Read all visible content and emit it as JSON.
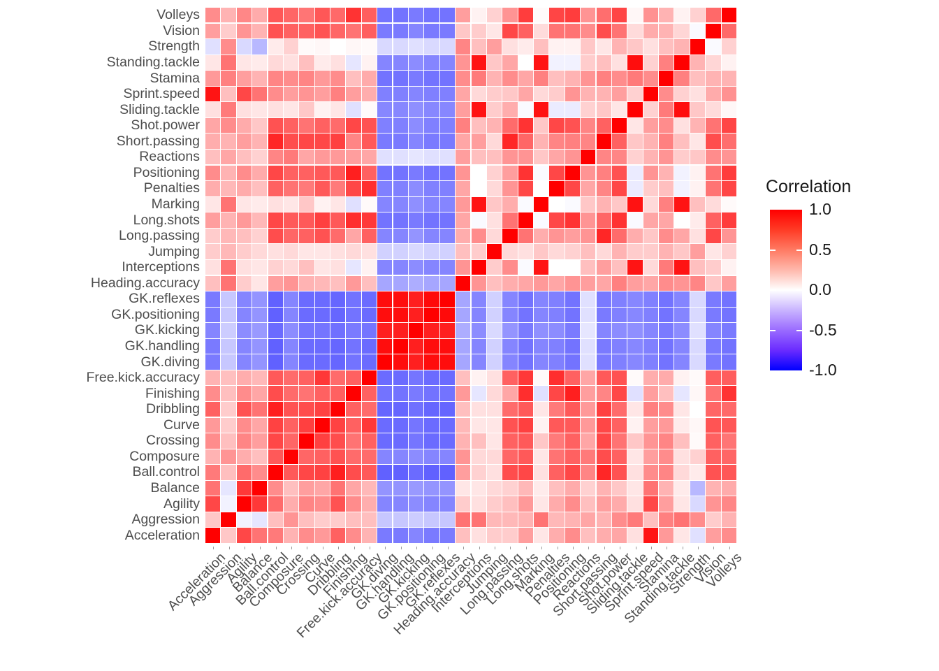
{
  "chart_data": {
    "type": "heatmap",
    "title": "",
    "xlabel": "",
    "ylabel": "",
    "legend": {
      "title": "Correlation",
      "position": "right",
      "ticks": [
        1.0,
        0.5,
        0.0,
        -0.5,
        -1.0
      ],
      "tick_labels": [
        "1.0",
        "0.5",
        "0.0",
        "-0.5",
        "-1.0"
      ],
      "zlim": [
        -1.0,
        1.0
      ],
      "colors": {
        "max": "#ff0000",
        "mid": "#ffffff",
        "min": "#0000ff"
      }
    },
    "grid": false,
    "x_categories": [
      "Acceleration",
      "Aggression",
      "Agility",
      "Balance",
      "Ball.control",
      "Composure",
      "Crossing",
      "Curve",
      "Dribbling",
      "Finishing",
      "Free.kick.accuracy",
      "GK.diving",
      "GK.handling",
      "GK.kicking",
      "GK.positioning",
      "GK.reflexes",
      "Heading.accuracy",
      "Interceptions",
      "Jumping",
      "Long.passing",
      "Long.shots",
      "Marking",
      "Penalties",
      "Positioning",
      "Reactions",
      "Short.passing",
      "Shot.power",
      "Sliding.tackle",
      "Sprint.speed",
      "Stamina",
      "Standing.tackle",
      "Strength",
      "Vision",
      "Volleys"
    ],
    "y_categories": [
      "Volleys",
      "Vision",
      "Strength",
      "Standing.tackle",
      "Stamina",
      "Sprint.speed",
      "Sliding.tackle",
      "Shot.power",
      "Short.passing",
      "Reactions",
      "Positioning",
      "Penalties",
      "Marking",
      "Long.shots",
      "Long.passing",
      "Jumping",
      "Interceptions",
      "Heading.accuracy",
      "GK.reflexes",
      "GK.positioning",
      "GK.kicking",
      "GK.handling",
      "GK.diving",
      "Free.kick.accuracy",
      "Finishing",
      "Dribbling",
      "Curve",
      "Crossing",
      "Composure",
      "Ball.control",
      "Balance",
      "Agility",
      "Aggression",
      "Acceleration"
    ],
    "matrix": [
      [
        0.45,
        0.3,
        0.47,
        0.33,
        0.66,
        0.6,
        0.54,
        0.66,
        0.59,
        0.8,
        0.63,
        -0.55,
        -0.55,
        -0.52,
        -0.55,
        -0.55,
        0.38,
        0.05,
        0.18,
        0.42,
        0.76,
        0.02,
        0.73,
        0.76,
        0.42,
        0.57,
        0.73,
        0.03,
        0.43,
        0.3,
        0.05,
        0.18,
        0.59,
        1.0
      ],
      [
        0.38,
        0.2,
        0.42,
        0.3,
        0.68,
        0.62,
        0.62,
        0.67,
        0.6,
        0.55,
        0.63,
        -0.52,
        -0.52,
        -0.48,
        -0.52,
        -0.52,
        0.22,
        0.2,
        0.1,
        0.72,
        0.62,
        0.14,
        0.55,
        0.55,
        0.45,
        0.7,
        0.55,
        0.14,
        0.33,
        0.3,
        0.16,
        -0.02,
        1.0,
        0.59
      ],
      [
        -0.12,
        0.45,
        -0.15,
        -0.28,
        0.08,
        0.18,
        0.02,
        0.03,
        0.0,
        0.03,
        0.02,
        -0.15,
        -0.15,
        -0.12,
        -0.15,
        -0.15,
        0.48,
        0.25,
        0.38,
        0.12,
        0.08,
        0.25,
        0.05,
        0.05,
        0.22,
        0.1,
        0.3,
        0.22,
        0.12,
        0.25,
        0.3,
        1.0,
        -0.02,
        0.18
      ],
      [
        0.1,
        0.55,
        0.1,
        0.08,
        0.15,
        0.12,
        0.25,
        0.08,
        0.12,
        -0.1,
        0.05,
        -0.48,
        -0.48,
        -0.45,
        -0.48,
        -0.48,
        0.42,
        0.92,
        0.22,
        0.35,
        0.0,
        0.92,
        -0.05,
        -0.05,
        0.2,
        0.25,
        0.12,
        0.95,
        0.18,
        0.5,
        1.0,
        0.3,
        0.16,
        0.05
      ],
      [
        0.4,
        0.5,
        0.38,
        0.3,
        0.48,
        0.45,
        0.48,
        0.4,
        0.45,
        0.25,
        0.33,
        -0.55,
        -0.55,
        -0.52,
        -0.55,
        -0.55,
        0.45,
        0.52,
        0.3,
        0.45,
        0.35,
        0.5,
        0.25,
        0.3,
        0.42,
        0.5,
        0.45,
        0.52,
        0.45,
        1.0,
        0.5,
        0.25,
        0.3,
        0.3
      ],
      [
        0.92,
        0.25,
        0.72,
        0.55,
        0.45,
        0.38,
        0.42,
        0.38,
        0.5,
        0.38,
        0.32,
        -0.5,
        -0.5,
        -0.48,
        -0.5,
        -0.5,
        0.35,
        0.15,
        0.2,
        0.22,
        0.35,
        0.15,
        0.2,
        0.42,
        0.3,
        0.3,
        0.38,
        0.18,
        1.0,
        0.45,
        0.18,
        0.12,
        0.33,
        0.43
      ],
      [
        0.12,
        0.52,
        0.12,
        0.1,
        0.12,
        0.1,
        0.22,
        0.05,
        0.1,
        -0.12,
        0.02,
        -0.47,
        -0.47,
        -0.44,
        -0.47,
        -0.47,
        0.38,
        0.92,
        0.2,
        0.32,
        -0.02,
        0.93,
        -0.08,
        -0.08,
        0.18,
        0.22,
        0.1,
        1.0,
        0.18,
        0.52,
        0.95,
        0.22,
        0.14,
        0.03
      ],
      [
        0.35,
        0.45,
        0.33,
        0.22,
        0.68,
        0.62,
        0.55,
        0.62,
        0.58,
        0.72,
        0.68,
        -0.5,
        -0.5,
        -0.45,
        -0.5,
        -0.5,
        0.5,
        0.25,
        0.3,
        0.58,
        0.8,
        0.22,
        0.72,
        0.68,
        0.48,
        0.62,
        1.0,
        0.1,
        0.38,
        0.45,
        0.12,
        0.3,
        0.55,
        0.73
      ],
      [
        0.32,
        0.3,
        0.38,
        0.3,
        0.85,
        0.7,
        0.72,
        0.72,
        0.75,
        0.48,
        0.65,
        -0.52,
        -0.52,
        -0.48,
        -0.52,
        -0.52,
        0.35,
        0.38,
        0.15,
        0.85,
        0.6,
        0.3,
        0.48,
        0.5,
        0.48,
        1.0,
        0.62,
        0.22,
        0.3,
        0.5,
        0.25,
        0.1,
        0.7,
        0.57
      ],
      [
        0.25,
        0.35,
        0.25,
        0.18,
        0.48,
        0.52,
        0.35,
        0.4,
        0.4,
        0.38,
        0.35,
        -0.12,
        -0.12,
        -0.1,
        -0.12,
        -0.12,
        0.38,
        0.25,
        0.25,
        0.42,
        0.42,
        0.22,
        0.35,
        0.42,
        1.0,
        0.48,
        0.48,
        0.18,
        0.3,
        0.42,
        0.2,
        0.22,
        0.45,
        0.42
      ],
      [
        0.45,
        0.3,
        0.45,
        0.33,
        0.72,
        0.62,
        0.62,
        0.65,
        0.65,
        0.88,
        0.62,
        -0.55,
        -0.55,
        -0.52,
        -0.55,
        -0.55,
        0.42,
        0.0,
        0.18,
        0.38,
        0.8,
        -0.02,
        0.72,
        1.0,
        0.42,
        0.5,
        0.68,
        -0.08,
        0.42,
        0.3,
        -0.05,
        0.05,
        0.55,
        0.76
      ],
      [
        0.32,
        0.28,
        0.33,
        0.25,
        0.62,
        0.55,
        0.52,
        0.65,
        0.52,
        0.72,
        0.82,
        -0.5,
        -0.5,
        -0.45,
        -0.5,
        -0.5,
        0.35,
        0.0,
        0.15,
        0.42,
        0.72,
        0.0,
        1.0,
        0.72,
        0.35,
        0.48,
        0.72,
        -0.08,
        0.2,
        0.25,
        -0.05,
        0.05,
        0.55,
        0.73
      ],
      [
        0.1,
        0.55,
        0.1,
        0.08,
        0.12,
        0.1,
        0.22,
        0.05,
        0.1,
        -0.12,
        0.02,
        -0.48,
        -0.48,
        -0.44,
        -0.48,
        -0.48,
        0.4,
        0.92,
        0.22,
        0.32,
        -0.02,
        1.0,
        0.0,
        -0.02,
        0.22,
        0.3,
        0.22,
        0.93,
        0.15,
        0.5,
        0.92,
        0.25,
        0.14,
        0.02
      ],
      [
        0.38,
        0.3,
        0.4,
        0.28,
        0.72,
        0.65,
        0.65,
        0.75,
        0.65,
        0.82,
        0.78,
        -0.55,
        -0.55,
        -0.52,
        -0.55,
        -0.55,
        0.35,
        -0.02,
        0.12,
        0.55,
        1.0,
        -0.02,
        0.72,
        0.8,
        0.42,
        0.6,
        0.8,
        -0.02,
        0.35,
        0.35,
        0.0,
        0.08,
        0.62,
        0.76
      ],
      [
        0.2,
        0.28,
        0.25,
        0.18,
        0.7,
        0.6,
        0.62,
        0.68,
        0.58,
        0.35,
        0.62,
        -0.48,
        -0.48,
        -0.42,
        -0.48,
        -0.48,
        0.32,
        0.45,
        0.15,
        1.0,
        0.55,
        0.32,
        0.42,
        0.38,
        0.42,
        0.85,
        0.58,
        0.32,
        0.22,
        0.45,
        0.35,
        0.12,
        0.72,
        0.42
      ],
      [
        0.2,
        0.28,
        0.2,
        0.15,
        0.12,
        0.15,
        0.1,
        0.1,
        0.12,
        0.15,
        0.12,
        -0.18,
        -0.18,
        -0.15,
        -0.18,
        -0.18,
        0.25,
        0.2,
        1.0,
        0.15,
        0.12,
        0.22,
        0.15,
        0.18,
        0.25,
        0.15,
        0.3,
        0.2,
        0.2,
        0.3,
        0.22,
        0.38,
        0.1,
        0.18
      ],
      [
        0.12,
        0.55,
        0.12,
        0.1,
        0.18,
        0.15,
        0.25,
        0.1,
        0.12,
        -0.1,
        0.05,
        -0.48,
        -0.48,
        -0.45,
        -0.48,
        -0.48,
        0.42,
        1.0,
        0.2,
        0.45,
        -0.02,
        0.92,
        0.0,
        0.0,
        0.25,
        0.38,
        0.25,
        0.92,
        0.15,
        0.52,
        0.92,
        0.25,
        0.2,
        0.05
      ],
      [
        0.25,
        0.55,
        0.2,
        0.1,
        0.38,
        0.42,
        0.3,
        0.28,
        0.25,
        0.4,
        0.25,
        -0.35,
        -0.35,
        -0.32,
        -0.35,
        -0.35,
        1.0,
        0.42,
        0.25,
        0.32,
        0.35,
        0.4,
        0.35,
        0.42,
        0.38,
        0.35,
        0.5,
        0.38,
        0.35,
        0.45,
        0.42,
        0.48,
        0.22,
        0.38
      ],
      [
        -0.52,
        -0.22,
        -0.48,
        -0.42,
        -0.62,
        -0.48,
        -0.58,
        -0.58,
        -0.6,
        -0.55,
        -0.58,
        0.95,
        0.95,
        0.88,
        0.96,
        1.0,
        -0.35,
        -0.48,
        -0.18,
        -0.48,
        -0.55,
        -0.48,
        -0.5,
        -0.55,
        -0.12,
        -0.52,
        -0.5,
        -0.47,
        -0.5,
        -0.55,
        -0.48,
        -0.15,
        -0.52,
        -0.55
      ],
      [
        -0.52,
        -0.22,
        -0.48,
        -0.42,
        -0.62,
        -0.48,
        -0.58,
        -0.58,
        -0.6,
        -0.55,
        -0.58,
        0.95,
        0.95,
        0.88,
        1.0,
        0.96,
        -0.35,
        -0.48,
        -0.18,
        -0.48,
        -0.55,
        -0.48,
        -0.5,
        -0.55,
        -0.12,
        -0.52,
        -0.5,
        -0.47,
        -0.5,
        -0.55,
        -0.48,
        -0.15,
        -0.52,
        -0.55
      ],
      [
        -0.48,
        -0.2,
        -0.45,
        -0.4,
        -0.58,
        -0.45,
        -0.54,
        -0.54,
        -0.56,
        -0.52,
        -0.54,
        0.88,
        0.88,
        1.0,
        0.88,
        0.88,
        -0.32,
        -0.45,
        -0.15,
        -0.42,
        -0.52,
        -0.44,
        -0.45,
        -0.52,
        -0.1,
        -0.48,
        -0.45,
        -0.44,
        -0.48,
        -0.52,
        -0.45,
        -0.12,
        -0.48,
        -0.52
      ],
      [
        -0.52,
        -0.22,
        -0.48,
        -0.42,
        -0.62,
        -0.48,
        -0.58,
        -0.58,
        -0.6,
        -0.55,
        -0.58,
        0.95,
        1.0,
        0.88,
        0.95,
        0.95,
        -0.35,
        -0.48,
        -0.18,
        -0.48,
        -0.55,
        -0.48,
        -0.5,
        -0.55,
        -0.12,
        -0.52,
        -0.5,
        -0.47,
        -0.5,
        -0.55,
        -0.48,
        -0.15,
        -0.52,
        -0.55
      ],
      [
        -0.52,
        -0.22,
        -0.48,
        -0.42,
        -0.62,
        -0.48,
        -0.58,
        -0.58,
        -0.6,
        -0.55,
        -0.58,
        1.0,
        0.95,
        0.88,
        0.95,
        0.95,
        -0.35,
        -0.48,
        -0.18,
        -0.48,
        -0.55,
        -0.48,
        -0.5,
        -0.55,
        -0.12,
        -0.52,
        -0.5,
        -0.47,
        -0.5,
        -0.55,
        -0.48,
        -0.15,
        -0.52,
        -0.55
      ],
      [
        0.3,
        0.25,
        0.32,
        0.28,
        0.65,
        0.58,
        0.62,
        0.78,
        0.58,
        0.62,
        1.0,
        -0.58,
        -0.58,
        -0.54,
        -0.58,
        -0.58,
        0.25,
        0.05,
        0.12,
        0.62,
        0.78,
        0.02,
        0.82,
        0.62,
        0.35,
        0.65,
        0.68,
        0.02,
        0.32,
        0.33,
        0.05,
        0.02,
        0.63,
        0.63
      ],
      [
        0.45,
        0.25,
        0.45,
        0.35,
        0.7,
        0.58,
        0.55,
        0.62,
        0.62,
        1.0,
        0.62,
        -0.55,
        -0.55,
        -0.52,
        -0.55,
        -0.55,
        0.4,
        -0.1,
        0.15,
        0.35,
        0.82,
        -0.12,
        0.72,
        0.88,
        0.38,
        0.48,
        0.72,
        -0.12,
        0.38,
        0.25,
        -0.1,
        0.03,
        0.55,
        0.8
      ],
      [
        0.62,
        0.2,
        0.68,
        0.55,
        0.88,
        0.68,
        0.7,
        0.74,
        1.0,
        0.62,
        0.58,
        -0.6,
        -0.6,
        -0.56,
        -0.6,
        -0.6,
        0.25,
        0.12,
        0.12,
        0.58,
        0.65,
        0.1,
        0.52,
        0.65,
        0.4,
        0.75,
        0.58,
        0.1,
        0.5,
        0.45,
        0.1,
        0.0,
        0.6,
        0.59
      ],
      [
        0.4,
        0.2,
        0.45,
        0.35,
        0.74,
        0.62,
        0.75,
        1.0,
        0.74,
        0.62,
        0.78,
        -0.58,
        -0.58,
        -0.54,
        -0.58,
        -0.58,
        0.28,
        0.1,
        0.1,
        0.68,
        0.75,
        0.05,
        0.65,
        0.65,
        0.4,
        0.72,
        0.62,
        0.05,
        0.38,
        0.4,
        0.08,
        0.03,
        0.67,
        0.66
      ],
      [
        0.45,
        0.25,
        0.48,
        0.38,
        0.72,
        0.6,
        1.0,
        0.75,
        0.7,
        0.55,
        0.62,
        -0.58,
        -0.58,
        -0.54,
        -0.58,
        -0.58,
        0.3,
        0.25,
        0.1,
        0.62,
        0.65,
        0.22,
        0.52,
        0.62,
        0.35,
        0.72,
        0.55,
        0.22,
        0.42,
        0.48,
        0.25,
        0.02,
        0.62,
        0.54
      ],
      [
        0.3,
        0.42,
        0.32,
        0.25,
        0.65,
        1.0,
        0.6,
        0.62,
        0.68,
        0.58,
        0.58,
        -0.48,
        -0.48,
        -0.45,
        -0.48,
        -0.48,
        0.42,
        0.15,
        0.15,
        0.6,
        0.65,
        0.1,
        0.55,
        0.62,
        0.52,
        0.7,
        0.62,
        0.1,
        0.38,
        0.45,
        0.12,
        0.18,
        0.62,
        0.6
      ],
      [
        0.52,
        0.25,
        0.58,
        0.45,
        1.0,
        0.65,
        0.72,
        0.74,
        0.88,
        0.7,
        0.65,
        -0.62,
        -0.62,
        -0.58,
        -0.62,
        -0.62,
        0.38,
        0.18,
        0.12,
        0.7,
        0.72,
        0.12,
        0.62,
        0.72,
        0.48,
        0.85,
        0.68,
        0.12,
        0.45,
        0.48,
        0.15,
        0.08,
        0.68,
        0.66
      ],
      [
        0.55,
        -0.1,
        0.78,
        1.0,
        0.45,
        0.25,
        0.38,
        0.35,
        0.55,
        0.35,
        0.28,
        -0.42,
        -0.42,
        -0.4,
        -0.42,
        -0.42,
        0.1,
        0.1,
        0.15,
        0.18,
        0.28,
        0.08,
        0.25,
        0.33,
        0.18,
        0.3,
        0.22,
        0.1,
        0.55,
        0.3,
        0.08,
        -0.28,
        0.3,
        0.33
      ],
      [
        0.72,
        -0.05,
        1.0,
        0.78,
        0.58,
        0.32,
        0.48,
        0.45,
        0.68,
        0.45,
        0.32,
        -0.48,
        -0.48,
        -0.45,
        -0.48,
        -0.48,
        0.2,
        0.12,
        0.2,
        0.25,
        0.4,
        0.1,
        0.33,
        0.45,
        0.25,
        0.38,
        0.33,
        0.12,
        0.72,
        0.38,
        0.1,
        -0.15,
        0.42,
        0.47
      ],
      [
        0.22,
        1.0,
        -0.05,
        -0.1,
        0.25,
        0.42,
        0.25,
        0.2,
        0.2,
        0.25,
        0.25,
        -0.22,
        -0.22,
        -0.2,
        -0.22,
        -0.22,
        0.55,
        0.55,
        0.28,
        0.28,
        0.3,
        0.55,
        0.28,
        0.3,
        0.35,
        0.3,
        0.45,
        0.52,
        0.25,
        0.5,
        0.55,
        0.45,
        0.2,
        0.3
      ],
      [
        1.0,
        0.22,
        0.72,
        0.55,
        0.52,
        0.3,
        0.45,
        0.4,
        0.62,
        0.45,
        0.3,
        -0.52,
        -0.52,
        -0.48,
        -0.52,
        -0.52,
        0.25,
        0.12,
        0.2,
        0.2,
        0.38,
        0.1,
        0.32,
        0.45,
        0.25,
        0.32,
        0.35,
        0.12,
        0.92,
        0.4,
        0.1,
        -0.12,
        0.38,
        0.45
      ]
    ]
  }
}
